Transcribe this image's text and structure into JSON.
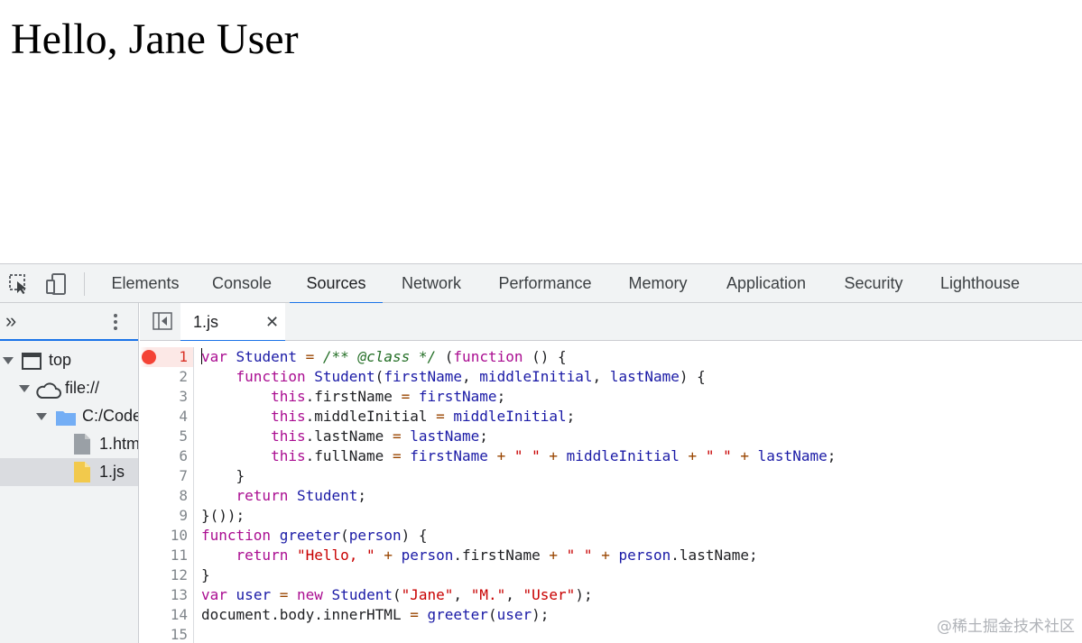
{
  "page": {
    "heading": "Hello, Jane User"
  },
  "devtools": {
    "tabs": [
      "Elements",
      "Console",
      "Sources",
      "Network",
      "Performance",
      "Memory",
      "Application",
      "Security",
      "Lighthouse"
    ],
    "active_tab": "Sources",
    "navigator": {
      "more_glyph": "»",
      "tree": [
        {
          "label": "top",
          "icon": "frame-icon"
        },
        {
          "label": "file://",
          "icon": "cloud-icon"
        },
        {
          "label": "C:/Code",
          "icon": "folder-icon"
        },
        {
          "label": "1.htm",
          "icon": "file-icon"
        },
        {
          "label": "1.js",
          "icon": "js-file-icon",
          "selected": true
        }
      ]
    },
    "editor": {
      "open_file": "1.js",
      "close_glyph": "✕",
      "breakpoint_line": 1,
      "line_numbers": [
        "1",
        "2",
        "3",
        "4",
        "5",
        "6",
        "7",
        "8",
        "9",
        "10",
        "11",
        "12",
        "13",
        "14",
        "15"
      ],
      "lines": [
        "var Student = /** @class */ (function () {",
        "    function Student(firstName, middleInitial, lastName) {",
        "        this.firstName = firstName;",
        "        this.middleInitial = middleInitial;",
        "        this.lastName = lastName;",
        "        this.fullName = firstName + \" \" + middleInitial + \" \" + lastName;",
        "    }",
        "    return Student;",
        "}());",
        "function greeter(person) {",
        "    return \"Hello, \" + person.firstName + \" \" + person.lastName;",
        "}",
        "var user = new Student(\"Jane\", \"M.\", \"User\");",
        "document.body.innerHTML = greeter(user);",
        ""
      ]
    }
  },
  "watermark": "@稀土掘金技术社区"
}
